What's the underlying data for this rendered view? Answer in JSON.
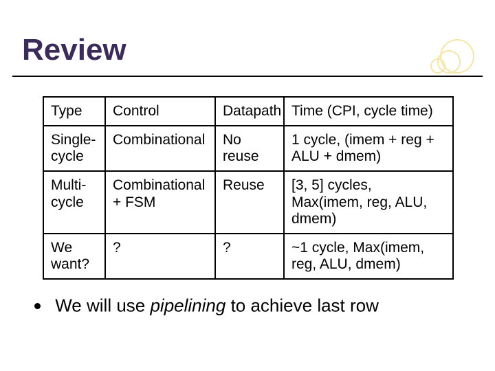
{
  "title": "Review",
  "table": {
    "header": {
      "c1": "Type",
      "c2": "Control",
      "c3": "Datapath",
      "c4": "Time (CPI, cycle time)"
    },
    "rows": [
      {
        "c1": "Single-cycle",
        "c2": "Combinational",
        "c3": "No reuse",
        "c4": "1 cycle, (imem + reg + ALU + dmem)"
      },
      {
        "c1": "Multi-cycle",
        "c2": "Combinational + FSM",
        "c3": "Reuse",
        "c4": "[3, 5] cycles, Max(imem, reg, ALU, dmem)"
      },
      {
        "c1": "We want?",
        "c2": "?",
        "c3": "?",
        "c4": "~1 cycle, Max(imem, reg, ALU, dmem)"
      }
    ]
  },
  "bullet": {
    "pre": "We will use ",
    "em": "pipelining",
    "post": " to achieve last row"
  },
  "chart_data": {
    "type": "table",
    "title": "Review",
    "columns": [
      "Type",
      "Control",
      "Datapath",
      "Time (CPI, cycle time)"
    ],
    "rows": [
      [
        "Single-cycle",
        "Combinational",
        "No reuse",
        "1 cycle, (imem + reg + ALU + dmem)"
      ],
      [
        "Multi-cycle",
        "Combinational + FSM",
        "Reuse",
        "[3, 5] cycles, Max(imem, reg, ALU, dmem)"
      ],
      [
        "We want?",
        "?",
        "?",
        "~1 cycle, Max(imem, reg, ALU, dmem)"
      ]
    ]
  }
}
